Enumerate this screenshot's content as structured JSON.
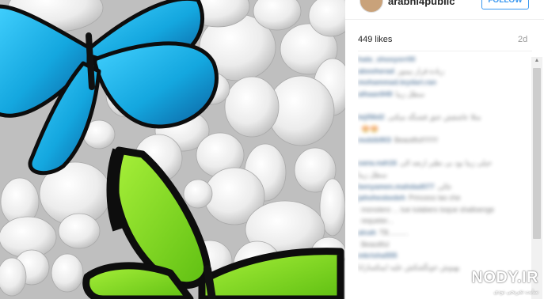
{
  "post": {
    "username": "arabhi4public",
    "follow_label": "FOLLOW",
    "likes": "449 likes",
    "age": "2d"
  },
  "photo": {
    "subject": "blue-butterfly-and-green-butterfly-on-white-pebbles",
    "colors": {
      "pebble": "#e9e9e9",
      "blue_wing": "#1fb4e8",
      "green_wing": "#7ed321",
      "wing_border": "#111111"
    }
  },
  "comments": [
    {
      "user": "hate_shooyorr00",
      "text": ""
    },
    {
      "user": "abooherad",
      "text": "زیادة قرار بیمور"
    },
    {
      "user": "mohammad.teydari.ran",
      "text": ""
    },
    {
      "user": "alhaan949",
      "text": "سطل زیبا"
    },
    {
      "user": "",
      "text": ""
    },
    {
      "user": "teji56d2",
      "text": "مثلا عاشقش عتق قشنگه میکنی"
    },
    {
      "user": "",
      "text": "😍😍"
    },
    {
      "user": "mobib903",
      "text": "Beautiful!!!!!!!!"
    },
    {
      "user": "",
      "text": ""
    },
    {
      "user": "sana.nah16",
      "text": "خیلی زیبا بود بی نظیر ارتعه الی"
    },
    {
      "user": "",
      "text": "سطل زیبا"
    },
    {
      "user": "benyamen.mahdad077",
      "text": "عالی"
    },
    {
      "user": "jahoheskedeh",
      "text": "Princess las che"
    },
    {
      "user": "",
      "text": "monstero ... tue tulabers toque shalloenge"
    },
    {
      "user": "",
      "text": "requeter..."
    },
    {
      "user": "alcah",
      "text": "TB.........."
    },
    {
      "user": "",
      "text": "Beautiful"
    },
    {
      "user": "mkrisha555",
      "text": ""
    },
    {
      "user": "",
      "text": "بهبوش خونگشکش علیه ایمکسازانا"
    },
    {
      "user": "",
      "text": ""
    }
  ],
  "watermark": {
    "main": "NODY.IR",
    "sub": "سایت تفریحی نودی"
  }
}
